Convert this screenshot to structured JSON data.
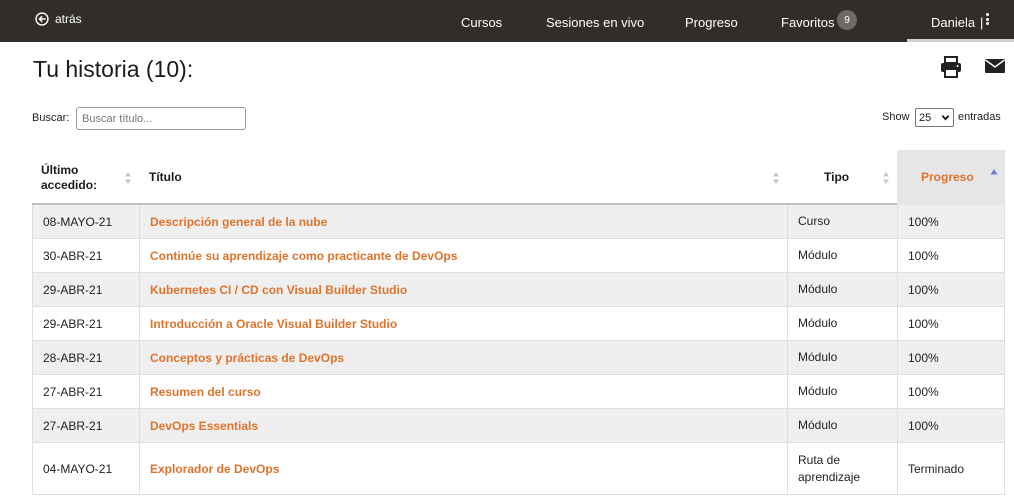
{
  "topbar": {
    "back_label": "atrás",
    "nav": [
      {
        "label": "Cursos"
      },
      {
        "label": "Sesiones en vivo"
      },
      {
        "label": "Progreso"
      },
      {
        "label": "Favoritos"
      }
    ],
    "favorites_count": "9",
    "user_name": "Daniela",
    "user_separator": "|",
    "background": "#312d2a"
  },
  "page": {
    "title": "Tu historia (10):",
    "accent_color": "#e0732c"
  },
  "search": {
    "label": "Buscar:",
    "placeholder": "Buscar título...",
    "value": ""
  },
  "length_menu": {
    "show_label": "Show",
    "selected": "25",
    "suffix": "entradas"
  },
  "table": {
    "columns": [
      "Último accedido:",
      "Título",
      "Tipo",
      "Progreso"
    ],
    "sorted_column": "Progreso",
    "rows": [
      {
        "date": "08-MAYO-21",
        "title": "Descripción general de la nube",
        "type": "Curso",
        "progress": "100%"
      },
      {
        "date": "30-ABR-21",
        "title": "Continúe su aprendizaje como practicante de DevOps",
        "type": "Módulo",
        "progress": "100%"
      },
      {
        "date": "29-ABR-21",
        "title": "Kubernetes CI / CD con Visual Builder Studio",
        "type": "Módulo",
        "progress": "100%"
      },
      {
        "date": "29-ABR-21",
        "title": "Introducción a Oracle Visual Builder Studio",
        "type": "Módulo",
        "progress": "100%"
      },
      {
        "date": "28-ABR-21",
        "title": "Conceptos y prácticas de DevOps",
        "type": "Módulo",
        "progress": "100%"
      },
      {
        "date": "27-ABR-21",
        "title": "Resumen del curso",
        "type": "Módulo",
        "progress": "100%"
      },
      {
        "date": "27-ABR-21",
        "title": "DevOps Essentials",
        "type": "Módulo",
        "progress": "100%"
      },
      {
        "date": "04-MAYO-21",
        "title": "Explorador de DevOps",
        "type": "Ruta de aprendizaje",
        "progress": "Terminado"
      }
    ]
  },
  "icons": [
    "back-circle-arrow-icon",
    "kebab-menu-icon",
    "print-icon",
    "mail-icon",
    "sort-icon",
    "sort-ascending-icon"
  ]
}
